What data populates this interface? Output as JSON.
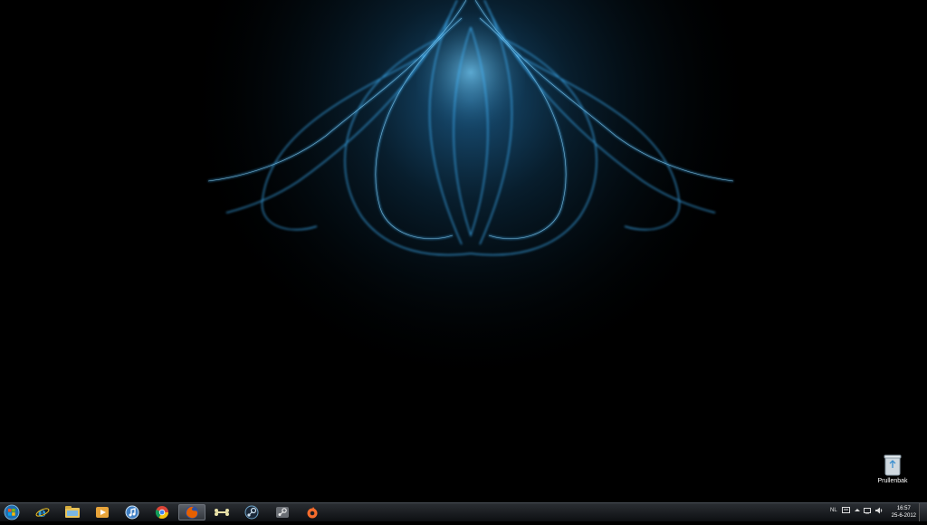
{
  "desktop": {
    "icons": [
      {
        "label": "Prullenbak",
        "icon": "recycle-bin-icon"
      }
    ]
  },
  "taskbar": {
    "start_icon": "windows-start-orb-icon",
    "pinned": [
      {
        "icon": "internet-explorer-icon"
      },
      {
        "icon": "windows-explorer-icon"
      },
      {
        "icon": "media-player-icon"
      },
      {
        "icon": "itunes-icon"
      },
      {
        "icon": "chrome-icon"
      },
      {
        "icon": "firefox-icon",
        "active": true
      },
      {
        "icon": "bone-app-icon"
      },
      {
        "icon": "steam-blue-icon"
      },
      {
        "icon": "steam-icon"
      },
      {
        "icon": "origin-icon"
      }
    ],
    "tray": {
      "language": "NL",
      "time": "16:57",
      "date": "25-6-2012"
    }
  },
  "colors": {
    "wallpaper_glow": "#2fa8ff",
    "taskbar_bg": "#1b1e22"
  }
}
